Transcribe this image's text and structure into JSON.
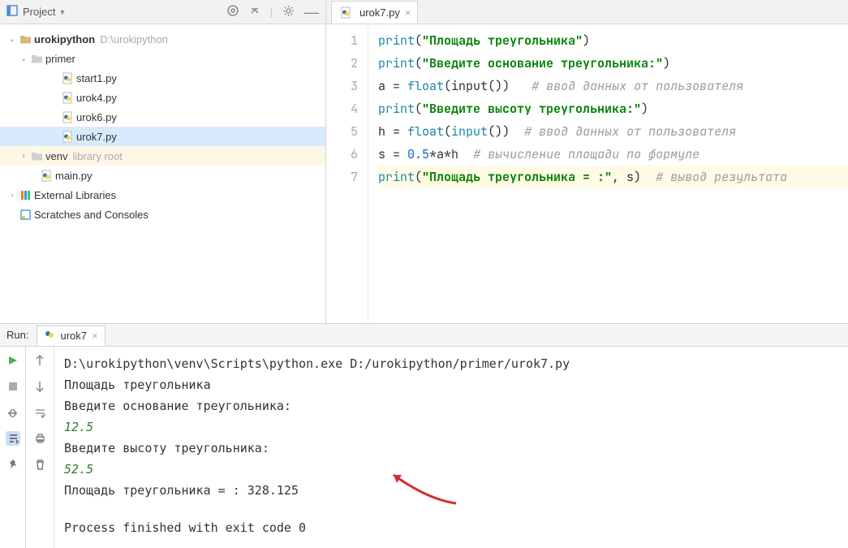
{
  "project": {
    "header_label": "Project",
    "root_name": "urokipython",
    "root_path": "D:\\urokipython",
    "folder_primer": "primer",
    "files": [
      "start1.py",
      "urok4.py",
      "urok6.py",
      "urok7.py"
    ],
    "venv_name": "venv",
    "venv_sub": "library root",
    "main_file": "main.py",
    "external_libs": "External Libraries",
    "scratches": "Scratches and Consoles"
  },
  "editor": {
    "tab_name": "urok7.py",
    "gutter": [
      "1",
      "2",
      "3",
      "4",
      "5",
      "6",
      "7"
    ],
    "line1": {
      "fn": "print",
      "paren1": "(",
      "str": "\"Площадь треугольника\"",
      "paren2": ")"
    },
    "line2": {
      "fn": "print",
      "paren1": "(",
      "str": "\"Введите основание треугольника:\"",
      "paren2": ")"
    },
    "line3": {
      "lhs": "a = ",
      "fn1": "float",
      "p1": "(",
      "fn2": "input",
      "p2": "())",
      "sp": "   ",
      "comment": "# ввод данных от пользователя"
    },
    "line4": {
      "fn": "print",
      "paren1": "(",
      "str": "\"Введите высоту треугольника:\"",
      "paren2": ")"
    },
    "line5": {
      "lhs": "h = ",
      "fn1": "float",
      "p1": "(",
      "fn2": "input",
      "p2": "())",
      "sp": "  ",
      "comment": "# ввод данных от пользователя"
    },
    "line6": {
      "lhs": "s = ",
      "num": "0.5",
      "rest": "*a*h",
      "sp": "  ",
      "comment": "# вычисление площади по формуле"
    },
    "line7": {
      "fn": "print",
      "paren1": "(",
      "str": "\"Площадь треугольника = :\"",
      "args": ", s)",
      "sp": "  ",
      "comment": "# вывод результата"
    }
  },
  "run": {
    "label": "Run:",
    "tab_name": "urok7",
    "lines": {
      "cmd": "D:\\urokipython\\venv\\Scripts\\python.exe D:/urokipython/primer/urok7.py",
      "out1": "Площадь треугольника",
      "out2": "Введите основание треугольника:",
      "in1": "12.5",
      "out3": "Введите высоту треугольника:",
      "in2": "52.5",
      "out4": "Площадь треугольника = : 328.125",
      "exit": "Process finished with exit code 0"
    }
  }
}
